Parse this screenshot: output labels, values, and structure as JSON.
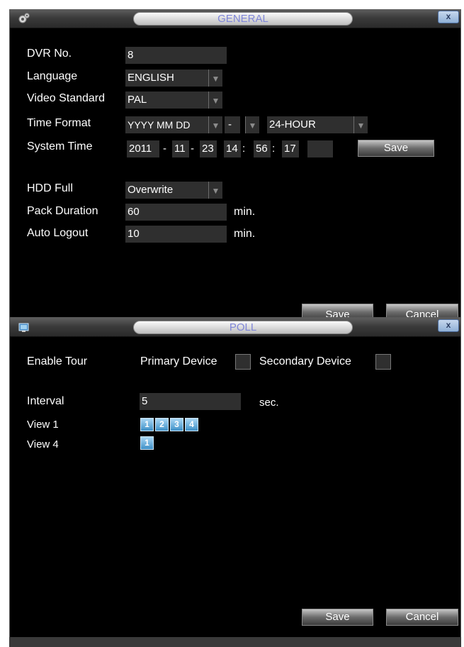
{
  "general": {
    "title": "GENERAL",
    "close": "x",
    "dvr_no": {
      "label": "DVR No.",
      "value": "8"
    },
    "language": {
      "label": "Language",
      "value": "ENGLISH"
    },
    "video_standard": {
      "label": "Video Standard",
      "value": "PAL"
    },
    "time_format": {
      "label": "Time Format",
      "date_format": "YYYY MM DD",
      "separator": "-",
      "hour_format": "24-HOUR"
    },
    "system_time": {
      "label": "System Time",
      "year": "2011",
      "month": "11",
      "day": "23",
      "hour": "14",
      "minute": "56",
      "second": "17",
      "date_sep": "-",
      "time_sep": ":",
      "save_label": "Save"
    },
    "hdd_full": {
      "label": "HDD Full",
      "value": "Overwrite"
    },
    "pack_duration": {
      "label": "Pack Duration",
      "value": "60",
      "unit": "min."
    },
    "auto_logout": {
      "label": "Auto Logout",
      "value": "10",
      "unit": "min."
    },
    "save_label": "Save",
    "cancel_label": "Cancel"
  },
  "poll": {
    "title": "POLL",
    "close": "x",
    "enable_tour": {
      "label": "Enable Tour",
      "primary_label": "Primary Device",
      "secondary_label": "Secondary Device",
      "primary_checked": false,
      "secondary_checked": false
    },
    "interval": {
      "label": "Interval",
      "value": "5",
      "unit": "sec."
    },
    "view1": {
      "label": "View 1",
      "buttons": [
        "1",
        "2",
        "3",
        "4"
      ]
    },
    "view4": {
      "label": "View 4",
      "buttons": [
        "1"
      ]
    },
    "save_label": "Save",
    "cancel_label": "Cancel"
  },
  "dropdown_arrow": "▼",
  "colors": {
    "title_text": "#7f86d8",
    "field_bg": "#2f2f2f",
    "view_button": "#3f91c8"
  }
}
